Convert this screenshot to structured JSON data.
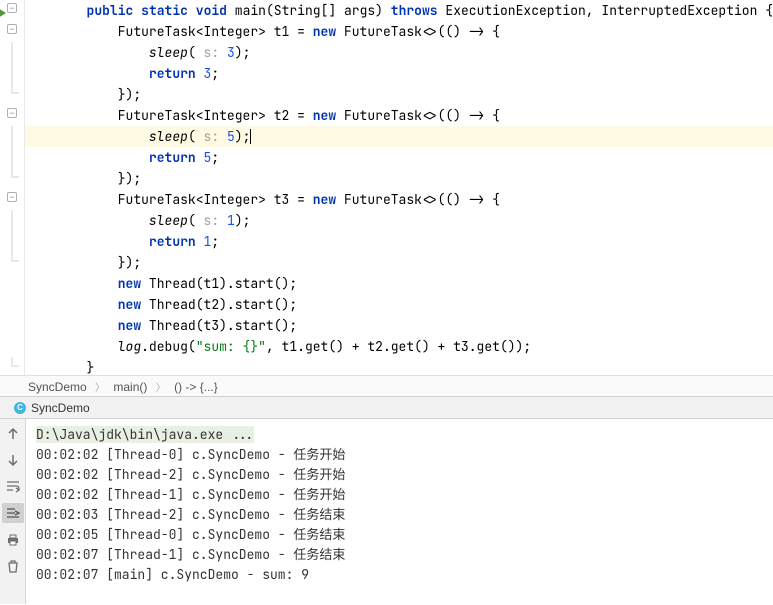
{
  "code": {
    "l1": {
      "i": "    ",
      "kw1": "public",
      "kw2": "static",
      "kw3": "void",
      "fn": " main(String[] args) ",
      "kw4": "throws",
      "rest": " ExecutionException, InterruptedException {"
    },
    "l2": {
      "i": "        ",
      "txt": "FutureTask<Integer> t1 = ",
      "kw": "new",
      "rest": " FutureTask<>(() -> {"
    },
    "l3": {
      "i": "            ",
      "fn": "sleep",
      "p": "(",
      "hint": " s: ",
      "num": "3",
      "end": ");"
    },
    "l4": {
      "i": "            ",
      "kw": "return",
      "sp": " ",
      "num": "3",
      "end": ";"
    },
    "l5": {
      "i": "        ",
      "txt": "});"
    },
    "l6": {
      "i": "        ",
      "txt": "FutureTask<Integer> t2 = ",
      "kw": "new",
      "rest": " FutureTask<>(() -> {"
    },
    "l7": {
      "i": "            ",
      "fn": "sleep",
      "p": "(",
      "hint": " s: ",
      "num": "5",
      "end": ");"
    },
    "l8": {
      "i": "            ",
      "kw": "return",
      "sp": " ",
      "num": "5",
      "end": ";"
    },
    "l9": {
      "i": "        ",
      "txt": "});"
    },
    "l10": {
      "i": "        ",
      "txt": "FutureTask<Integer> t3 = ",
      "kw": "new",
      "rest": " FutureTask<>(() -> {"
    },
    "l11": {
      "i": "            ",
      "fn": "sleep",
      "p": "(",
      "hint": " s: ",
      "num": "1",
      "end": ");"
    },
    "l12": {
      "i": "            ",
      "kw": "return",
      "sp": " ",
      "num": "1",
      "end": ";"
    },
    "l13": {
      "i": "        ",
      "txt": "});"
    },
    "l14": {
      "i": "        ",
      "kw": "new",
      "rest": " Thread(t1).start();"
    },
    "l15": {
      "i": "        ",
      "kw": "new",
      "rest": " Thread(t2).start();"
    },
    "l16": {
      "i": "        ",
      "kw": "new",
      "rest": " Thread(t3).start();"
    },
    "l17": {
      "i": "        ",
      "obj": "log",
      "dot": ".debug(",
      "str": "\"sum: {}\"",
      "rest": ", t1.get() + t2.get() + t3.get());"
    },
    "l18": {
      "i": "    ",
      "txt": "}"
    }
  },
  "breadcrumb": {
    "b1": "SyncDemo",
    "b2": "main()",
    "b3": "() -> {...}"
  },
  "tab": {
    "label": "SyncDemo"
  },
  "console": {
    "cmd": "D:\\Java\\jdk\\bin\\java.exe ...",
    "lines": [
      "00:02:02 [Thread-0] c.SyncDemo - 任务开始",
      "00:02:02 [Thread-2] c.SyncDemo - 任务开始",
      "00:02:02 [Thread-1] c.SyncDemo - 任务开始",
      "00:02:03 [Thread-2] c.SyncDemo - 任务结束",
      "00:02:05 [Thread-0] c.SyncDemo - 任务结束",
      "00:02:07 [Thread-1] c.SyncDemo - 任务结束",
      "00:02:07 [main] c.SyncDemo - sum: 9"
    ]
  }
}
